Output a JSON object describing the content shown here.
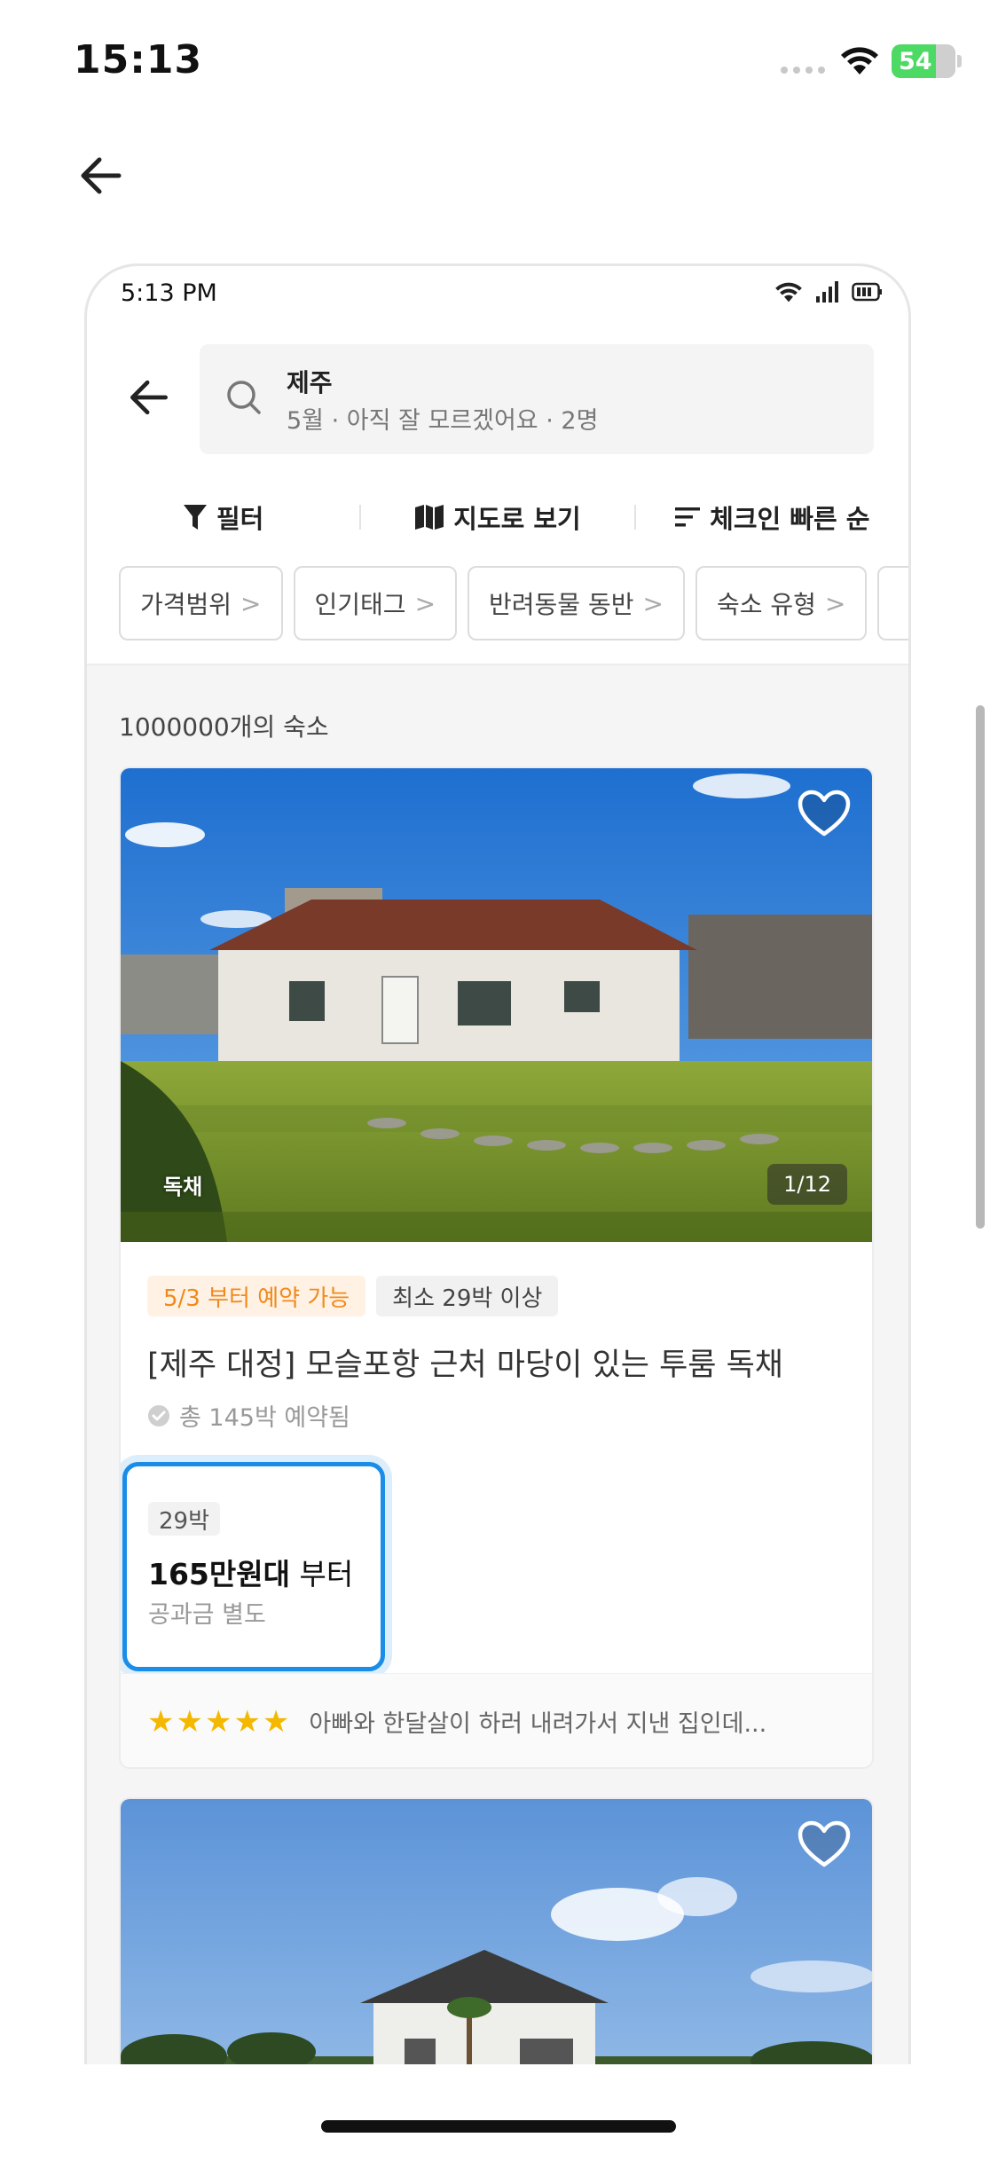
{
  "ios_status": {
    "time": "15:13",
    "battery": "54"
  },
  "inner_status": {
    "time": "5:13 PM"
  },
  "search": {
    "title": "제주",
    "subtitle": "5월 · 아직 잘 모르겠어요 · 2명"
  },
  "toolbar": {
    "filter": "필터",
    "map": "지도로 보기",
    "sort": "체크인 빠른 순"
  },
  "chips": [
    "가격범위",
    "인기태그",
    "반려동물 동반",
    "숙소 유형"
  ],
  "list": {
    "count": "1000000개의 숙소"
  },
  "listing1": {
    "photo_tag": "독채",
    "photo_counter": "1/12",
    "badge_available": "5/3 부터 예약 가능",
    "badge_min": "최소 29박 이상",
    "title": "[제주 대정] 모슬포항 근처 마당이 있는 투룸 독채",
    "booked": "총 145박 예약됨",
    "nights": "29박",
    "price_amount": "165만원대",
    "price_suffix": " 부터",
    "utility": "공과금 별도",
    "rating_stars": "★★★★★",
    "review": "아빠와 한달살이 하러 내려가서 지낸 집인데..."
  },
  "colors": {
    "accent": "#1a8de8",
    "orange": "#f08a1c",
    "star": "#f5b800"
  }
}
